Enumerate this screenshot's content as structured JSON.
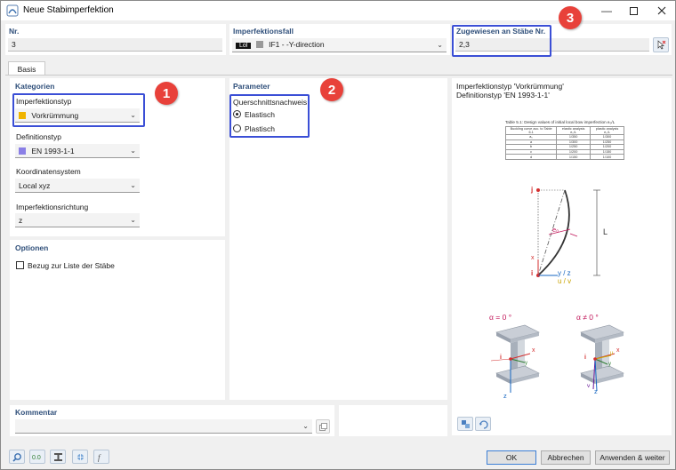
{
  "window": {
    "title": "Neue Stabimperfektion"
  },
  "top": {
    "nr_label": "Nr.",
    "nr_value": "3",
    "case_label": "Imperfektionsfall",
    "case_badge": "Lol",
    "case_value": "IF1 - -Y-direction",
    "assigned_label": "Zugewiesen an Stäbe Nr.",
    "assigned_value": "2,3"
  },
  "tabs": [
    "Basis"
  ],
  "kategorien": {
    "header": "Kategorien",
    "type_label": "Imperfektionstyp",
    "type_value": "Vorkrümmung",
    "def_label": "Definitionstyp",
    "def_value": "EN 1993-1-1",
    "coord_label": "Koordinatensystem",
    "coord_value": "Local xyz",
    "dir_label": "Imperfektionsrichtung",
    "dir_value": "z"
  },
  "optionen": {
    "header": "Optionen",
    "checkbox_label": "Bezug zur Liste der Stäbe"
  },
  "parameter": {
    "header": "Parameter",
    "group_label": "Querschnittsnachweis",
    "options": [
      "Elastisch",
      "Plastisch"
    ],
    "selected": "Elastisch"
  },
  "preview": {
    "line1": "Imperfektionstyp 'Vorkrümmung'",
    "line2": "Definitionstyp 'EN 1993-1-1'",
    "table_caption": "Table 5.1: Design values of initial local bow imperfection e₀/L",
    "table_head": [
      "Buckling curve acc. to Table 6.1",
      "elastic analysis e₀/L",
      "plastic analysis e₀/L"
    ],
    "table_rows": [
      [
        "a₀",
        "1/350",
        "1/300"
      ],
      [
        "a",
        "1/300",
        "1/250"
      ],
      [
        "b",
        "1/250",
        "1/200"
      ],
      [
        "c",
        "1/200",
        "1/150"
      ],
      [
        "d",
        "1/150",
        "1/100"
      ]
    ],
    "diag": {
      "j": "j",
      "i": "i",
      "x": "x",
      "e0": "e₀",
      "L": "L",
      "y_z": "y / z",
      "u_v": "u / v"
    },
    "alpha0": "α = 0 °",
    "alphaN": "α ≠ 0 °",
    "lbl_x": "x",
    "lbl_i": "i",
    "lbl_y": "y",
    "lbl_z": "z",
    "lbl_u": "u",
    "lbl_v": "v"
  },
  "kommentar": {
    "header": "Kommentar"
  },
  "badges": [
    "1",
    "2",
    "3"
  ],
  "buttons": {
    "ok": "OK",
    "cancel": "Abbrechen",
    "apply": "Anwenden & weiter"
  },
  "colors": {
    "accent": "#3b4fd6",
    "badge": "#e8413a",
    "header_text": "#2f4f7a",
    "type_swatch": "#f0b400",
    "def_swatch": "#8a7fe6",
    "case_swatch": "#9a9a9a"
  }
}
